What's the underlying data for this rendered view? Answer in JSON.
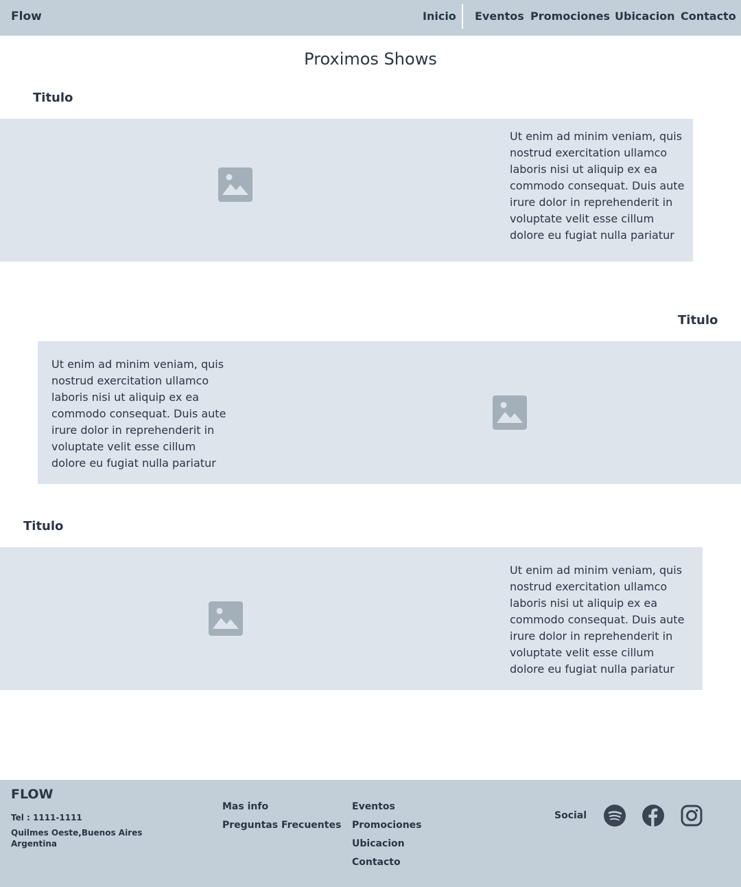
{
  "nav": {
    "brand": "Flow",
    "items": [
      {
        "label": "Inicio"
      },
      {
        "label": "Eventos"
      },
      {
        "label": "Promociones"
      },
      {
        "label": "Ubicacion"
      },
      {
        "label": "Contacto"
      }
    ]
  },
  "main": {
    "title": "Proximos Shows",
    "shows": [
      {
        "title": "Titulo",
        "text": "Ut enim ad minim veniam, quis nostrud exercitation ullamco laboris nisi ut aliquip ex ea commodo consequat. Duis aute irure dolor in reprehenderit in voluptate velit esse cillum dolore eu fugiat nulla pariatur",
        "image_icon": "image-placeholder-icon"
      },
      {
        "title": "Titulo",
        "text": "Ut enim ad minim veniam, quis nostrud exercitation ullamco laboris nisi ut aliquip ex ea commodo consequat. Duis aute irure dolor in reprehenderit in voluptate velit esse cillum dolore eu fugiat nulla pariatur",
        "image_icon": "image-placeholder-icon"
      },
      {
        "title": "Titulo",
        "text": "Ut enim ad minim veniam, quis nostrud exercitation ullamco laboris nisi ut aliquip ex ea commodo consequat. Duis aute irure dolor in reprehenderit in voluptate velit esse cillum dolore eu fugiat nulla pariatur",
        "image_icon": "image-placeholder-icon"
      }
    ]
  },
  "footer": {
    "brand": "FLOW",
    "phone": "Tel : 1111-1111",
    "address": "Quilmes Oeste,Buenos Aires Argentina",
    "info_links": [
      {
        "label": "Mas info"
      },
      {
        "label": "Preguntas Frecuentes"
      }
    ],
    "nav_links": [
      {
        "label": "Eventos"
      },
      {
        "label": "Promociones"
      },
      {
        "label": "Ubicacion"
      },
      {
        "label": "Contacto"
      }
    ],
    "social_label": "Social",
    "social_icons": [
      "spotify-icon",
      "facebook-icon",
      "instagram-icon"
    ]
  },
  "colors": {
    "navbar_bg": "#c3cfd8",
    "card_bg": "#dee4ec",
    "text": "#2b3545",
    "placeholder_icon": "#a3afb9"
  }
}
